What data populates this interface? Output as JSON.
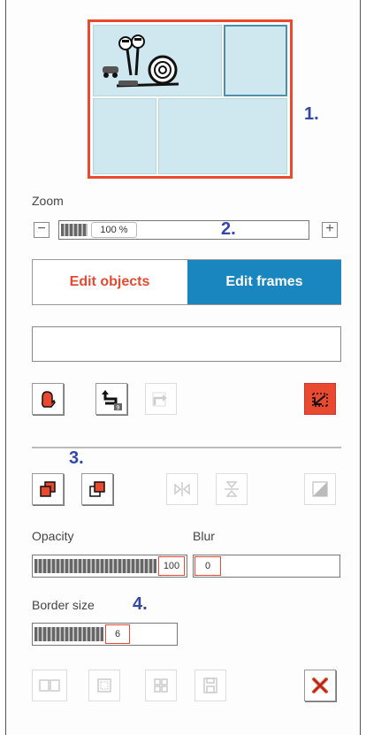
{
  "annotations": {
    "n1": "1.",
    "n2": "2.",
    "n3": "3.",
    "n4": "4."
  },
  "zoom": {
    "label": "Zoom",
    "minus": "−",
    "plus": "+",
    "value": "100 %"
  },
  "modes": {
    "objects": "Edit objects",
    "frames": "Edit frames",
    "active": "frames"
  },
  "opacity": {
    "label": "Opacity",
    "value": "100",
    "level": 1.0
  },
  "blur": {
    "label": "Blur",
    "value": "0",
    "level": 0.0
  },
  "border": {
    "label": "Border size",
    "value": "6",
    "level": 0.6
  },
  "colors": {
    "accent": "#e8492f",
    "mode_active": "#1a86c0",
    "frame_fill": "#cfe7ef",
    "annotation": "#3447a8"
  },
  "icons": {
    "toolbar1": [
      "glove-icon",
      "undo-icon",
      "redo-icon",
      "crop-frame-icon"
    ],
    "toolbar2": [
      "bring-forward-icon",
      "send-backward-icon",
      "flip-horizontal-icon",
      "flip-vertical-icon",
      "gradient-icon"
    ],
    "toolbar3": [
      "layout-two-icon",
      "layout-single-icon",
      "layout-grid-icon",
      "save-icon",
      "delete-icon"
    ]
  }
}
